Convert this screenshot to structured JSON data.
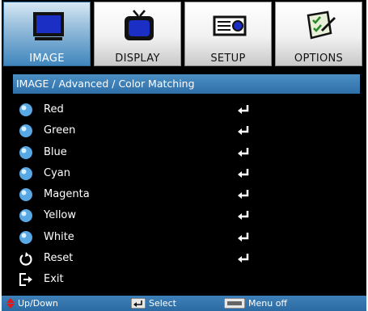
{
  "tabs": [
    {
      "label": "IMAGE",
      "icon": "monitor-icon",
      "active": true
    },
    {
      "label": "DISPLAY",
      "icon": "tv-icon",
      "active": false
    },
    {
      "label": "SETUP",
      "icon": "projector-icon",
      "active": false
    },
    {
      "label": "OPTIONS",
      "icon": "options-icon",
      "active": false
    }
  ],
  "breadcrumb": "IMAGE / Advanced / Color Matching",
  "menu": {
    "items": [
      {
        "label": "Red",
        "icon": "color-dot-icon"
      },
      {
        "label": "Green",
        "icon": "color-dot-icon"
      },
      {
        "label": "Blue",
        "icon": "color-dot-icon"
      },
      {
        "label": "Cyan",
        "icon": "color-dot-icon"
      },
      {
        "label": "Magenta",
        "icon": "color-dot-icon"
      },
      {
        "label": "Yellow",
        "icon": "color-dot-icon"
      },
      {
        "label": "White",
        "icon": "color-dot-icon"
      },
      {
        "label": "Reset",
        "icon": "reset-icon"
      },
      {
        "label": "Exit",
        "icon": "exit-icon"
      }
    ],
    "enter_icon": "enter-icon"
  },
  "footer": {
    "updown_label": "Up/Down",
    "select_label": "Select",
    "menu_off_label": "Menu off"
  },
  "colors": {
    "accent": "#3f86bd",
    "background": "#000000",
    "updown_arrow": "#e01a1a"
  }
}
